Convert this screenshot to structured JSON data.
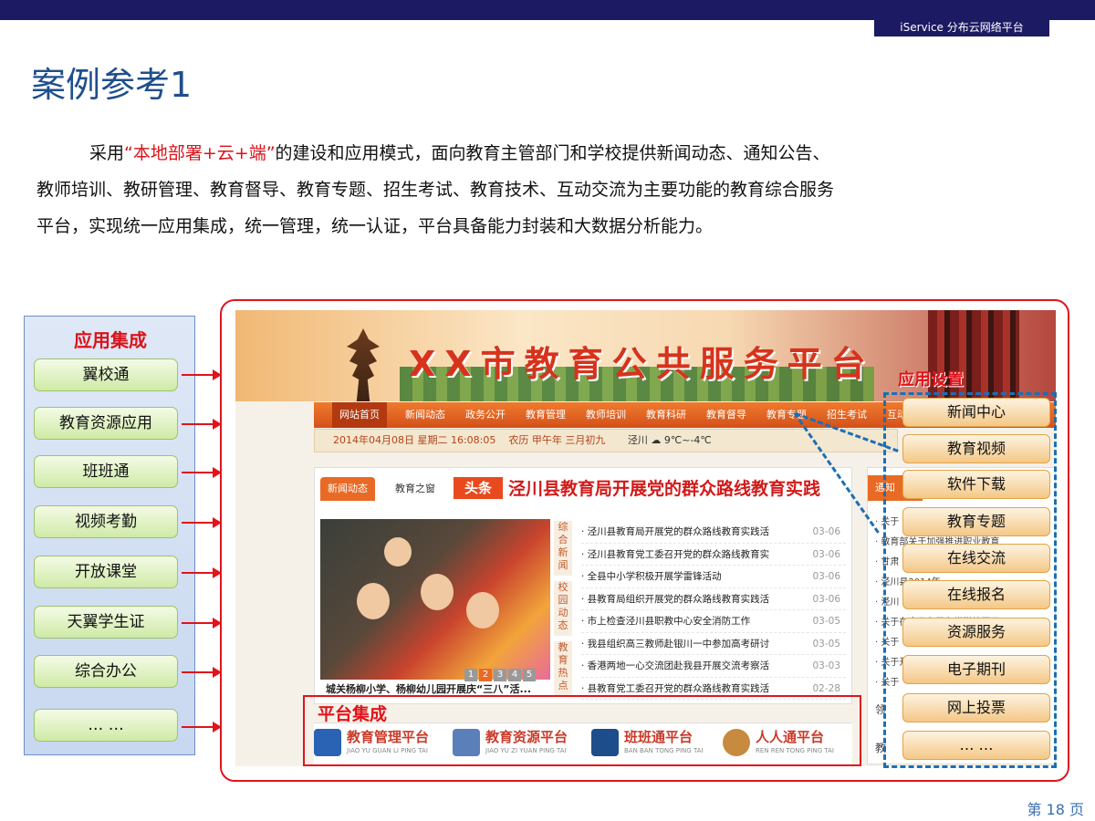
{
  "header": {
    "brand": "iService 分布云网络平台"
  },
  "slide": {
    "title": "案例参考1",
    "intro_pre": "采用",
    "intro_highlight": "“本地部署+云+端”",
    "intro_post_line1": "的建设和应用模式，面向教育主管部门和学校提供新闻动态、通知公告、",
    "intro_line2": "教师培训、教研管理、教育督导、教育专题、招生考试、教育技术、互动交流为主要功能的教育综合服务",
    "intro_line3": "平台，实现统一应用集成，统一管理，统一认证，平台具备能力封装和大数据分析能力。",
    "page_number": "第 18 页"
  },
  "left_panel": {
    "title": "应用集成",
    "apps": [
      "翼校通",
      "教育资源应用",
      "班班通",
      "视频考勤",
      "开放课堂",
      "天翼学生证",
      "综合办公",
      "… …"
    ]
  },
  "portal": {
    "banner_title": "XX市教育公共服务平台",
    "nav": [
      "网站首页",
      "新闻动态",
      "政务公开",
      "教育管理",
      "教师培训",
      "教育科研",
      "教育督导",
      "教育专题",
      "招生考试",
      "互动"
    ],
    "datebar": {
      "date": "2014年04月08日 星期二 16:08:05",
      "lunar": "农历 甲午年 三月初九",
      "city": "泾川",
      "weather": "9℃~-4℃"
    },
    "news_tabs": [
      "新闻动态",
      "教育之窗"
    ],
    "headline_tag": "头条",
    "headline": "泾川县教育局开展党的群众路线教育实践",
    "photo_pager": [
      "1",
      "2",
      "3",
      "4",
      "5"
    ],
    "photo_caption": "城关杨柳小学、杨柳幼儿园开展庆“三八”活...",
    "side_tabs": [
      "综合新闻",
      "校园动态",
      "教育热点"
    ],
    "news_items": [
      {
        "title": "· 泾川县教育局开展党的群众路线教育实践活",
        "date": "03-06"
      },
      {
        "title": "· 泾川县教育党工委召开党的群众路线教育实",
        "date": "03-06"
      },
      {
        "title": "· 全县中小学积极开展学雷锋活动",
        "date": "03-06"
      },
      {
        "title": "· 县教育局组织开展党的群众路线教育实践活",
        "date": "03-06"
      },
      {
        "title": "· 市上检查泾川县职教中心安全消防工作",
        "date": "03-05"
      },
      {
        "title": "· 我县组织高三教师赴银川一中参加高考研讨",
        "date": "03-05"
      },
      {
        "title": "· 香港两地一心交流团赴我县开展交流考察活",
        "date": "03-03"
      },
      {
        "title": "· 县教育党工委召开党的群众路线教育实践活",
        "date": "02-28"
      }
    ],
    "notice_head": "通知",
    "notice_items": [
      "· 关于",
      "· 教育部关于加强推进职业教育",
      "· 甘肃",
      "· 泾川县2014年…",
      "· 泾川",
      "· 关于在全县各级各类学校开展",
      "· 关于",
      "· 关于开展教育系统…",
      "· 关于"
    ],
    "notice_extra": [
      "领",
      "教"
    ],
    "platforms": [
      {
        "name": "教育管理平台",
        "pinyin": "JIAO YU GUAN LI PING TAI",
        "color": "#2a63b4"
      },
      {
        "name": "教育资源平台",
        "pinyin": "JIAO YU ZI YUAN PING TAI",
        "color": "#5b7fb8"
      },
      {
        "name": "班班通平台",
        "pinyin": "BAN BAN TONG PING TAI",
        "color": "#1d4d8a"
      },
      {
        "name": "人人通平台",
        "pinyin": "REN REN TONG PING TAI",
        "color": "#c88a3e"
      }
    ]
  },
  "callouts": {
    "platform_integration": "平台集成",
    "app_settings": "应用设置",
    "settings": [
      "新闻中心",
      "教育视频",
      "软件下载",
      "教育专题",
      "在线交流",
      "在线报名",
      "资源服务",
      "电子期刊",
      "网上投票",
      "… …"
    ]
  }
}
